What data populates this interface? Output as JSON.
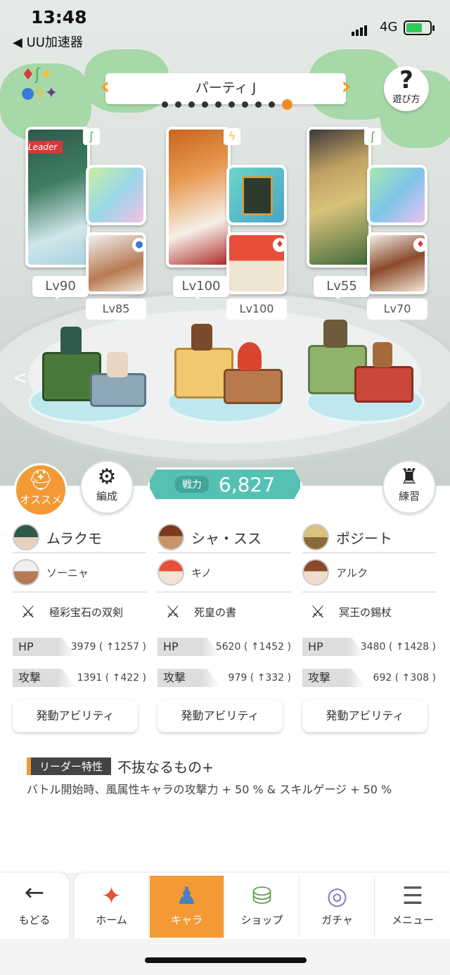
{
  "status": {
    "time": "13:48",
    "back_app": "◀ UU加速器",
    "network": "4G"
  },
  "party": {
    "title": "パーティ J",
    "page_count": 10,
    "current_page": 10
  },
  "help": {
    "icon": "?",
    "label": "遊び方"
  },
  "cards": [
    {
      "leader_badge": "Leader",
      "attr": "wind",
      "level": "Lv90",
      "sub_level": "Lv85",
      "sub_attr": "water"
    },
    {
      "attr": "thunder",
      "level": "Lv100",
      "sub_level": "Lv100",
      "sub_attr": "fire"
    },
    {
      "attr": "wind",
      "level": "Lv55",
      "sub_level": "Lv70",
      "sub_attr": "fire"
    }
  ],
  "buttons": {
    "recommend": "オススメ",
    "formation": "編成",
    "practice": "練習"
  },
  "power": {
    "label": "戦力",
    "value": "6,827"
  },
  "members": [
    {
      "main": "ムラクモ",
      "sub": "ソーニャ",
      "weapon": "極彩宝石の双剣",
      "hp_label": "HP",
      "hp": "3979 ( ↑1257 )",
      "atk_label": "攻撃",
      "atk": "1391 ( ↑422 )",
      "ability": "発動アビリティ"
    },
    {
      "main": "シャ・スス",
      "sub": "キノ",
      "weapon": "死皇の書",
      "hp_label": "HP",
      "hp": "5620 ( ↑1452 )",
      "atk_label": "攻撃",
      "atk": "979 ( ↑332 )",
      "ability": "発動アビリティ"
    },
    {
      "main": "ポジート",
      "sub": "アルク",
      "weapon": "冥王の錫杖",
      "hp_label": "HP",
      "hp": "3480 ( ↑1428 )",
      "atk_label": "攻撃",
      "atk": "692 ( ↑308 )",
      "ability": "発動アビリティ"
    }
  ],
  "leader_skill": {
    "tag": "リーダー特性",
    "name": "不抜なるもの+",
    "desc": "バトル開始時、風属性キャラの攻撃力 + 50 % & スキルゲージ + 50 %"
  },
  "nav": {
    "back": "もどる",
    "home": "ホーム",
    "chara": "キャラ",
    "shop": "ショップ",
    "gacha": "ガチャ",
    "menu": "メニュー"
  },
  "colors": {
    "accent": "#f39a36",
    "power": "#55c1b3",
    "leader_red": "#d93838"
  }
}
